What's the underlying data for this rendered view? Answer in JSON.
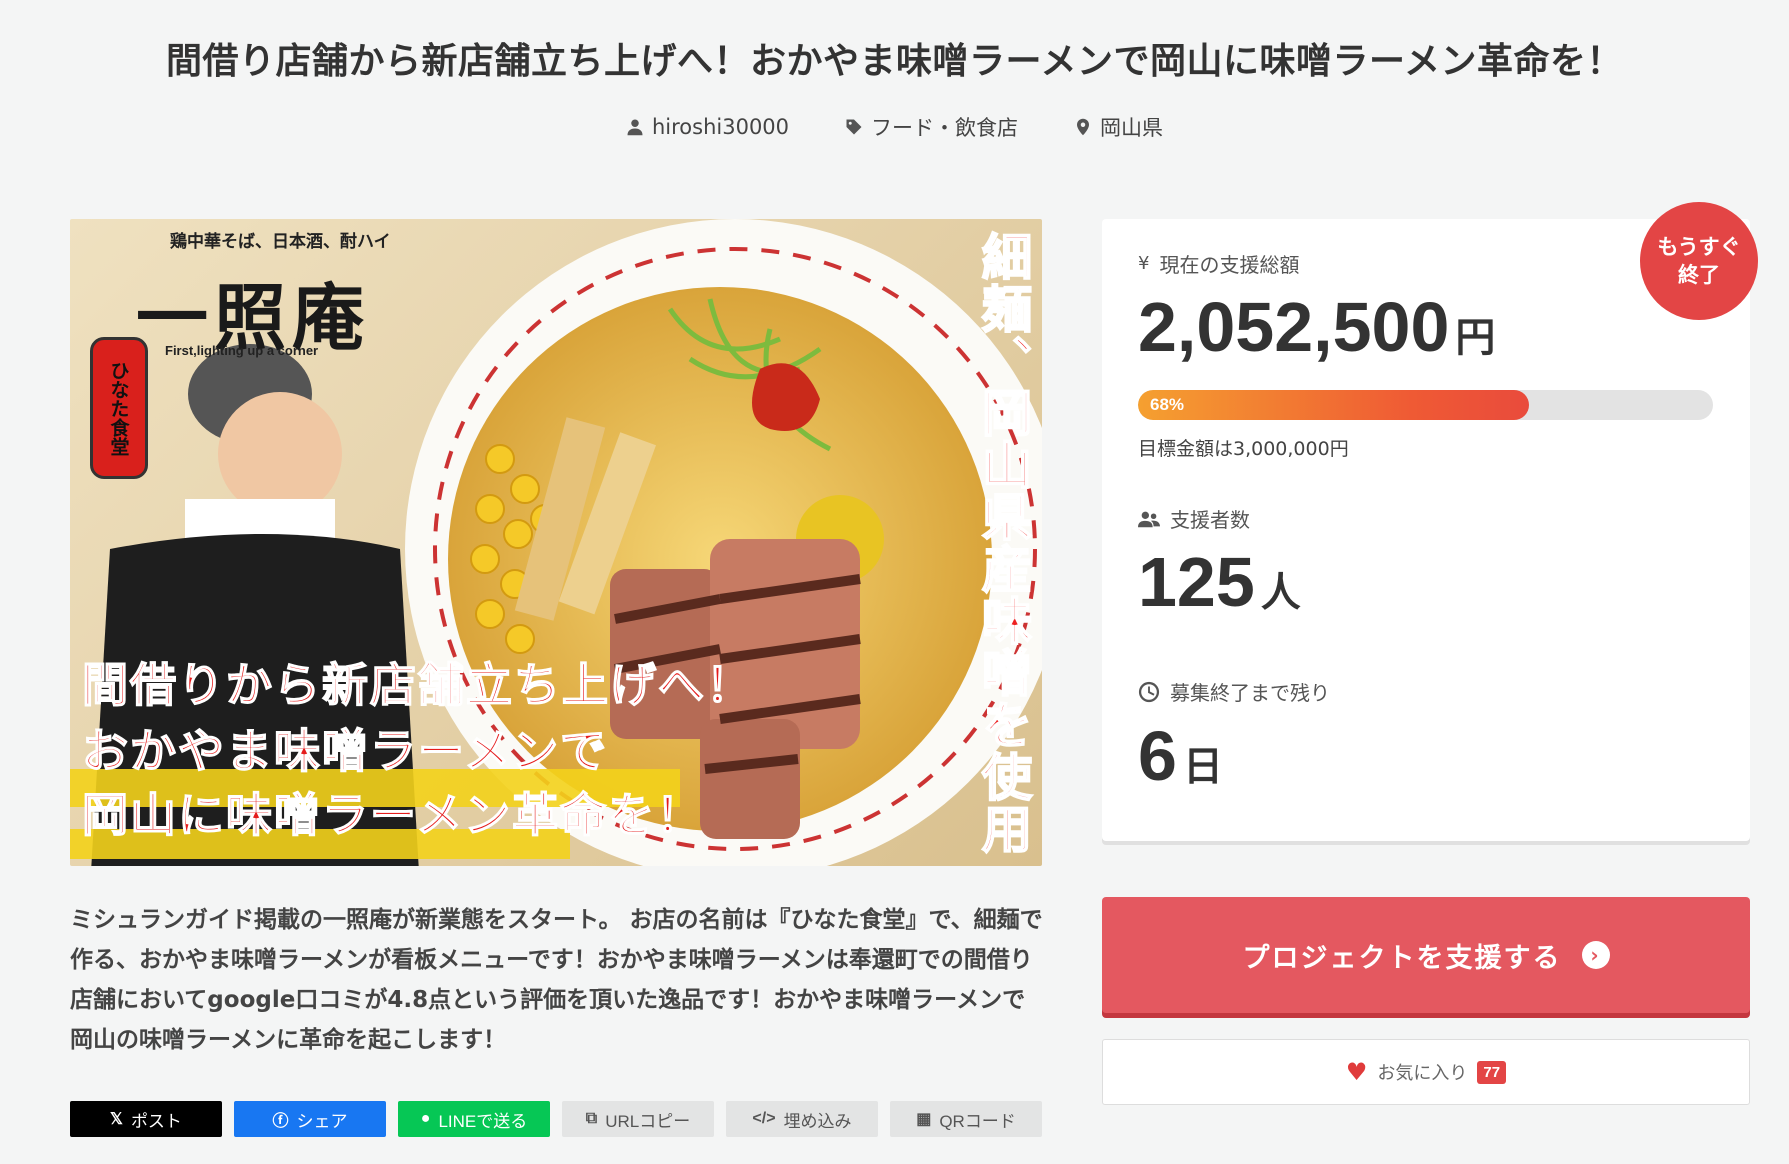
{
  "page": {
    "title": "間借り店舗から新店舗立ち上げへ！おかやま味噌ラーメンで岡山に味噌ラーメン革命を！"
  },
  "meta": {
    "author": "hiroshi30000",
    "category": "フード・飲食店",
    "location": "岡山県"
  },
  "hero": {
    "brand_small": "鶏中華そば、日本酒、酎ハイ",
    "brand_big": "一照庵",
    "brand_sub": "First,lighting up a corner",
    "lantern": "ひなた食堂",
    "vertical_text": "細麺、岡山県産味噌を使用",
    "line1": "間借りから新店舗立ち上げへ！",
    "line2": "おかやま味噌ラーメンで",
    "line3": "岡山に味噌ラーメン革命を！"
  },
  "description": "ミシュランガイド掲載の一照庵が新業態をスタート。 お店の名前は『ひなた食堂』で、細麺で作る、おかやま味噌ラーメンが看板メニューです！おかやま味噌ラーメンは奉還町での間借り店舗においてgoogle口コミが4.8点という評価を頂いた逸品です！おかやま味噌ラーメンで 岡山の味噌ラーメンに革命を起こします！",
  "share": {
    "post": "ポスト",
    "facebook": "シェア",
    "line": "LINEで送る",
    "url_copy": "URLコピー",
    "embed": "埋め込み",
    "qr": "QRコード"
  },
  "stats": {
    "badge_line1": "もうすぐ",
    "badge_line2": "終了",
    "total_label": "現在の支援総額",
    "total_amount": "2,052,500",
    "total_unit": "円",
    "progress_percent": 68,
    "progress_label": "68%",
    "goal_text": "目標金額は3,000,000円",
    "supporters_label": "支援者数",
    "supporters_count": "125",
    "supporters_unit": "人",
    "remaining_label": "募集終了まで残り",
    "remaining_days": "6",
    "remaining_unit": "日"
  },
  "actions": {
    "support_label": "プロジェクトを支援する",
    "favorite_label": "お気に入り",
    "favorite_count": "77"
  },
  "colors": {
    "accent": "#e45860",
    "badge": "#e34545",
    "x": "#000000",
    "facebook": "#1877f2",
    "line": "#06c755"
  }
}
